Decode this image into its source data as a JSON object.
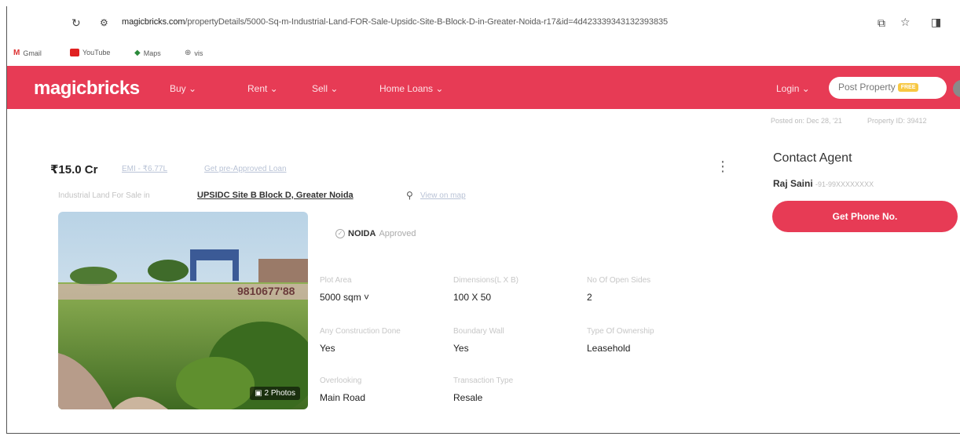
{
  "browser": {
    "url_host": "magicbricks.com",
    "url_path": "/propertyDetails/5000-Sq-m-Industrial-Land-FOR-Sale-Upsidc-Site-B-Block-D-in-Greater-Noida-r17&id=4d423339343132393835",
    "bookmarks": [
      "Gmail",
      "YouTube",
      "Maps",
      "vis"
    ]
  },
  "header": {
    "logo": "magicbricks",
    "nav": [
      "Buy ⌄",
      "Rent ⌄",
      "Sell ⌄",
      "Home Loans ⌄"
    ],
    "login": "Login ⌄",
    "post_property": "Post Property",
    "free_badge": "FREE",
    "brand_color": "#e73b55"
  },
  "meta": {
    "posted": "Posted on: Dec 28, '21",
    "property_id": "Property ID: 39412"
  },
  "listing": {
    "price": "₹15.0 Cr",
    "emi": "EMI - ₹6.77L",
    "loan": "Get pre-Approved Loan",
    "subtitle": "Industrial Land For Sale in",
    "location": "UPSIDC Site B Block D, Greater Noida",
    "view_map": "View on map",
    "photos": "2 Photos",
    "approval_authority": "NOIDA",
    "approval_text": "Approved",
    "details": [
      {
        "label": "Plot Area",
        "value": "5000 sqm ˅"
      },
      {
        "label": "Dimensions(L X B)",
        "value": "100 X 50"
      },
      {
        "label": "No Of Open Sides",
        "value": "2"
      },
      {
        "label": "Any Construction Done",
        "value": "Yes"
      },
      {
        "label": "Boundary Wall",
        "value": "Yes"
      },
      {
        "label": "Type Of Ownership",
        "value": "Leasehold"
      },
      {
        "label": "Overlooking",
        "value": "Main Road"
      },
      {
        "label": "Transaction Type",
        "value": "Resale"
      }
    ]
  },
  "contact": {
    "title": "Contact Agent",
    "agent_name": "Raj Saini",
    "agent_phone_masked": "-91-99XXXXXXXX",
    "button": "Get Phone No."
  }
}
